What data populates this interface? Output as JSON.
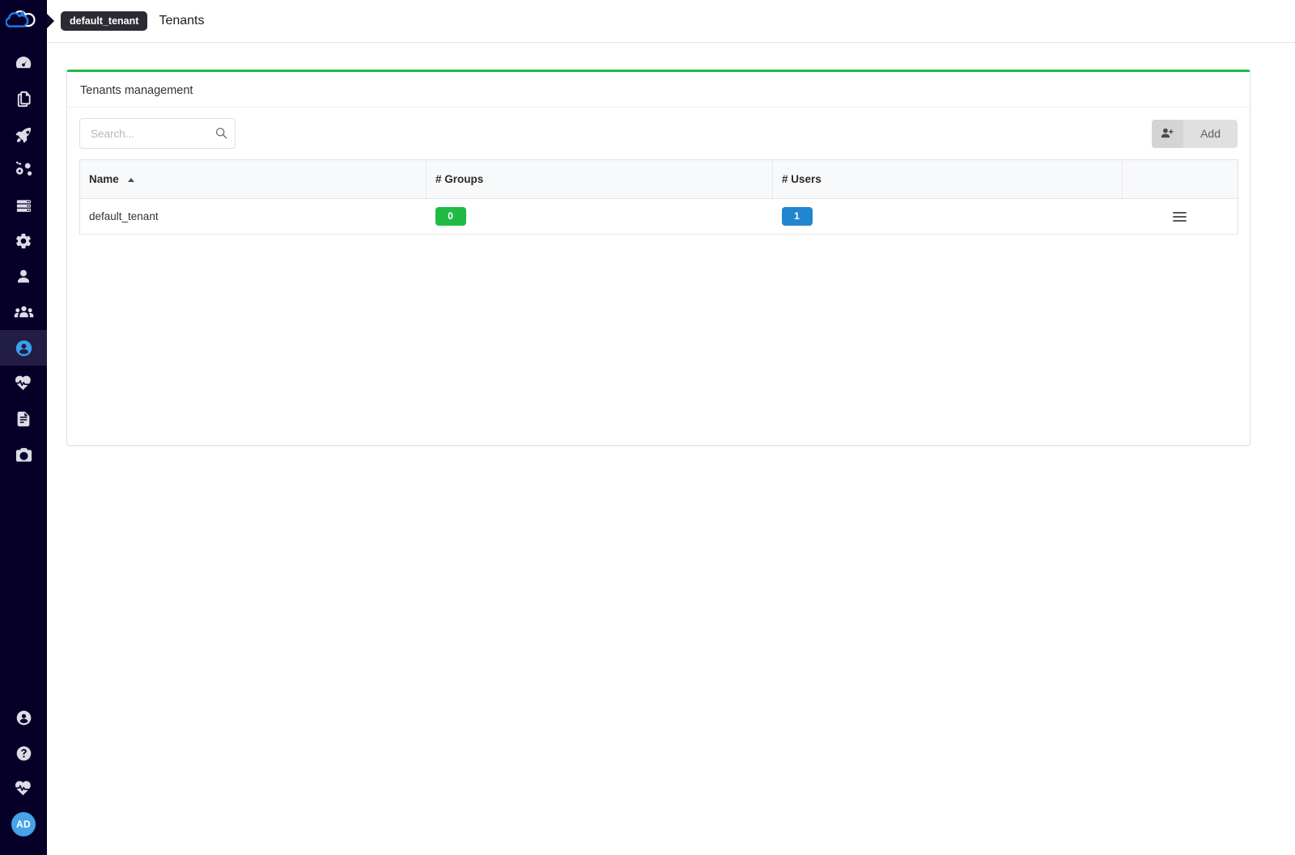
{
  "app": {
    "logo_icon": "cloudify-cloud-logo",
    "accent_green": "#21ba45",
    "accent_blue": "#2185d0",
    "sidebar_bg": "#060029"
  },
  "header": {
    "breadcrumb_tenant": "default_tenant",
    "page_title": "Tenants"
  },
  "sidebar": {
    "top_items": [
      {
        "icon": "dashboard-icon",
        "name": "sidebar-item-dashboard",
        "active": false
      },
      {
        "icon": "blueprints-icon",
        "name": "sidebar-item-blueprints",
        "active": false
      },
      {
        "icon": "deployments-icon",
        "name": "sidebar-item-deployments",
        "active": false
      },
      {
        "icon": "services-icon",
        "name": "sidebar-item-services",
        "active": false
      },
      {
        "icon": "servers-icon",
        "name": "sidebar-item-servers",
        "active": false
      },
      {
        "icon": "settings-icon",
        "name": "sidebar-item-settings",
        "active": false
      },
      {
        "icon": "user-icon",
        "name": "sidebar-item-users",
        "active": false
      },
      {
        "icon": "user-group-icon",
        "name": "sidebar-item-user-groups",
        "active": false
      },
      {
        "icon": "tenants-icon",
        "name": "sidebar-item-tenants",
        "active": true
      },
      {
        "icon": "heartbeat-icon",
        "name": "sidebar-item-health",
        "active": false
      },
      {
        "icon": "logs-icon",
        "name": "sidebar-item-logs",
        "active": false
      },
      {
        "icon": "snapshots-icon",
        "name": "sidebar-item-snapshots",
        "active": false
      }
    ],
    "bottom_items": [
      {
        "icon": "account-icon",
        "name": "sidebar-item-account"
      },
      {
        "icon": "help-icon",
        "name": "sidebar-item-help"
      },
      {
        "icon": "status-icon",
        "name": "sidebar-item-status"
      }
    ],
    "avatar_initials": "AD"
  },
  "card": {
    "title": "Tenants management"
  },
  "search": {
    "value": "",
    "placeholder": "Search...",
    "icon": "search-icon"
  },
  "add_button": {
    "label": "Add",
    "icon": "user-plus-icon"
  },
  "table": {
    "columns": [
      {
        "label": "Name",
        "sorted": "asc"
      },
      {
        "label": "# Groups",
        "sorted": null
      },
      {
        "label": "# Users",
        "sorted": null
      },
      {
        "label": "",
        "sorted": null
      }
    ],
    "rows": [
      {
        "name": "default_tenant",
        "groups": "0",
        "groups_color": "green",
        "users": "1",
        "users_color": "blue",
        "menu_icon": "hamburger-menu-icon"
      }
    ]
  }
}
